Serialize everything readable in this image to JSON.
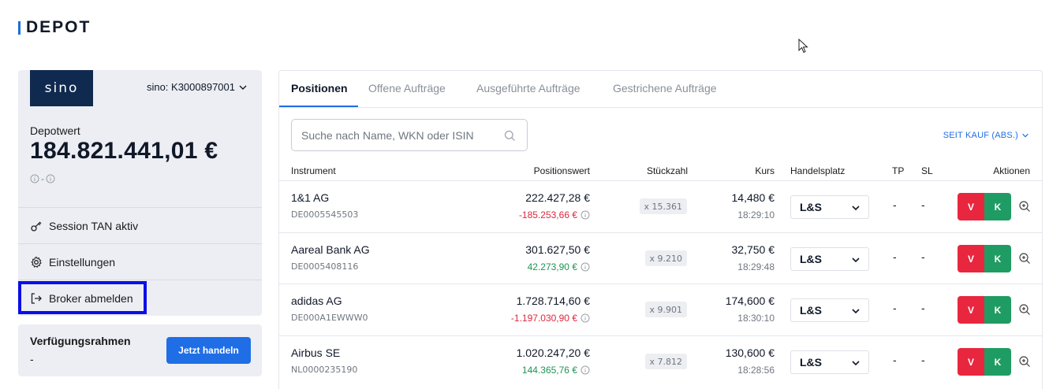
{
  "header": {
    "title": "DEPOT"
  },
  "broker": {
    "logo_text": "sino",
    "account": "sino: K3000897001",
    "depot_label": "Depotwert",
    "depot_value": "184.821.441,01 €",
    "depot_sub": "-"
  },
  "menu": {
    "session_tan": "Session TAN aktiv",
    "settings": "Einstellungen",
    "logout": "Broker abmelden"
  },
  "verfuegung": {
    "label": "Verfügungsrahmen",
    "value": "-",
    "button": "Jetzt handeln"
  },
  "tabs": [
    {
      "label": "Positionen",
      "active": true
    },
    {
      "label": "Offene Aufträge",
      "active": false
    },
    {
      "label": "Ausgeführte Aufträge",
      "active": false
    },
    {
      "label": "Gestrichene Aufträge",
      "active": false
    }
  ],
  "search": {
    "placeholder": "Suche nach Name, WKN oder ISIN"
  },
  "since_label": "SEIT KAUF (ABS.)",
  "columns": {
    "instrument": "Instrument",
    "positionswert": "Positionswert",
    "stueckzahl": "Stückzahl",
    "kurs": "Kurs",
    "handelsplatz": "Handelsplatz",
    "tp": "TP",
    "sl": "SL",
    "aktionen": "Aktionen"
  },
  "positions": [
    {
      "name": "1&1 AG",
      "isin": "DE0005545503",
      "value": "222.427,28 €",
      "delta": "-185.253,66 €",
      "delta_sign": "neg",
      "qty": "x 15.361",
      "price": "14,480 €",
      "time": "18:29:10",
      "venue": "L&S",
      "tp": "-",
      "sl": "-",
      "sell": "V",
      "buy": "K"
    },
    {
      "name": "Aareal Bank AG",
      "isin": "DE0005408116",
      "value": "301.627,50 €",
      "delta": "42.273,90 €",
      "delta_sign": "pos",
      "qty": "x 9.210",
      "price": "32,750 €",
      "time": "18:29:48",
      "venue": "L&S",
      "tp": "-",
      "sl": "-",
      "sell": "V",
      "buy": "K"
    },
    {
      "name": "adidas AG",
      "isin": "DE000A1EWWW0",
      "value": "1.728.714,60 €",
      "delta": "-1.197.030,90 €",
      "delta_sign": "neg",
      "qty": "x 9.901",
      "price": "174,600 €",
      "time": "18:30:10",
      "venue": "L&S",
      "tp": "-",
      "sl": "-",
      "sell": "V",
      "buy": "K"
    },
    {
      "name": "Airbus SE",
      "isin": "NL0000235190",
      "value": "1.020.247,20 €",
      "delta": "144.365,76 €",
      "delta_sign": "pos",
      "qty": "x 7.812",
      "price": "130,600 €",
      "time": "18:28:56",
      "venue": "L&S",
      "tp": "-",
      "sl": "-",
      "sell": "V",
      "buy": "K"
    }
  ]
}
